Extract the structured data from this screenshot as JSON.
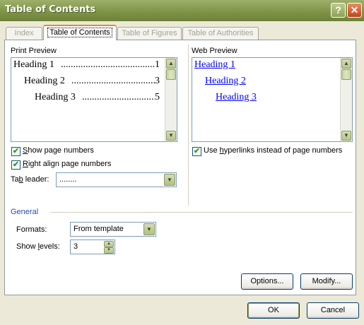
{
  "window": {
    "title": "Table of Contents",
    "help_label": "?",
    "close_label": "✕"
  },
  "tabs": [
    {
      "label": "Index",
      "active": false
    },
    {
      "label": "Table of Contents",
      "active": true
    },
    {
      "label": "Table of Figures",
      "active": false
    },
    {
      "label": "Table of Authorities",
      "active": false
    }
  ],
  "print_preview": {
    "label": "Print Preview",
    "entries": [
      {
        "text": "Heading 1",
        "page": "1",
        "dots": "......................................."
      },
      {
        "text": "Heading 2",
        "page": "3",
        "dots": "......................................."
      },
      {
        "text": "Heading 3",
        "page": "5",
        "dots": "......................................."
      }
    ]
  },
  "web_preview": {
    "label": "Web Preview",
    "entries": [
      "Heading 1",
      "Heading 2",
      "Heading 3"
    ]
  },
  "options": {
    "show_page_numbers": {
      "pre": "",
      "key": "S",
      "post": "how page numbers",
      "checked": true
    },
    "right_align": {
      "pre": "",
      "key": "R",
      "post": "ight align page numbers",
      "checked": true
    },
    "use_hyperlinks": {
      "pre": "Use ",
      "key": "h",
      "post": "yperlinks instead of page numbers",
      "checked": true
    },
    "tab_leader": {
      "pre": "Ta",
      "key": "b",
      "post": " leader:",
      "value": "........"
    }
  },
  "general": {
    "label": "General",
    "formats": {
      "pre": "Formats:",
      "key": "",
      "post": "",
      "value": "From template"
    },
    "show_levels": {
      "pre": "Show ",
      "key": "l",
      "post": "evels:",
      "value": "3"
    }
  },
  "buttons": {
    "options": "Options...",
    "modify": "Modify...",
    "ok": "OK",
    "cancel": "Cancel"
  },
  "icons": {
    "check": "✔",
    "down": "▼",
    "up": "▲"
  }
}
